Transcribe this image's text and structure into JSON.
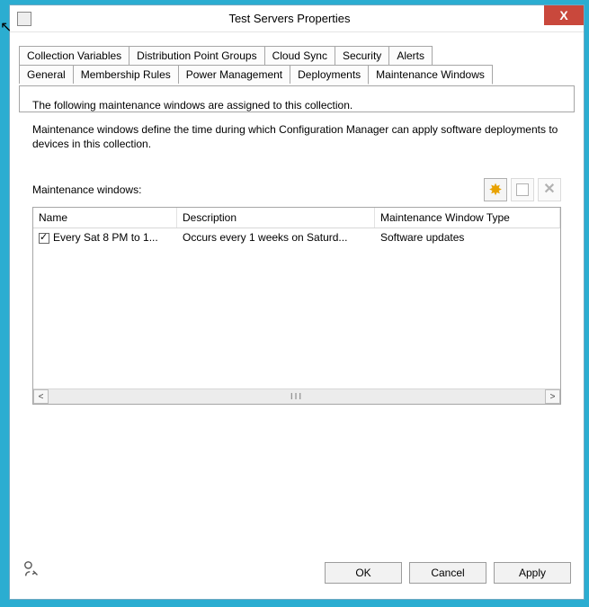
{
  "window": {
    "title": "Test Servers Properties",
    "close": "X"
  },
  "tabs": {
    "row_back": [
      {
        "label": "Collection Variables"
      },
      {
        "label": "Distribution Point Groups"
      },
      {
        "label": "Cloud Sync"
      },
      {
        "label": "Security"
      },
      {
        "label": "Alerts"
      }
    ],
    "row_front": [
      {
        "label": "General"
      },
      {
        "label": "Membership Rules"
      },
      {
        "label": "Power Management"
      },
      {
        "label": "Deployments"
      },
      {
        "label": "Maintenance Windows",
        "active": true
      }
    ]
  },
  "panel": {
    "intro1": "The following maintenance windows are assigned to this collection.",
    "intro2": "Maintenance windows define the time during which Configuration Manager can apply software deployments to devices in this collection.",
    "list_label": "Maintenance windows:"
  },
  "toolbar": {
    "new": "New",
    "properties": "Properties",
    "delete": "Delete"
  },
  "columns": {
    "name": "Name",
    "description": "Description",
    "type": "Maintenance Window Type"
  },
  "rows": [
    {
      "checked": true,
      "name": "Every Sat 8 PM to 1...",
      "description": "Occurs every 1 weeks on Saturd...",
      "type": "Software updates"
    }
  ],
  "buttons": {
    "ok": "OK",
    "cancel": "Cancel",
    "apply": "Apply"
  }
}
